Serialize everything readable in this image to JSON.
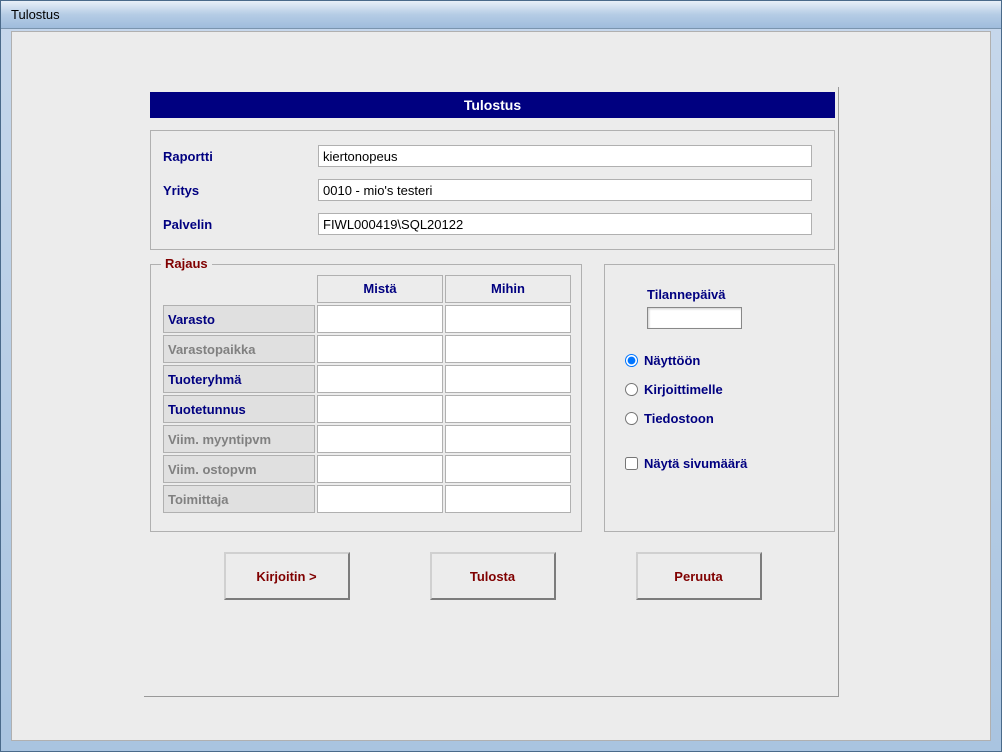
{
  "window": {
    "title": "Tulostus"
  },
  "panel": {
    "header": "Tulostus"
  },
  "info": {
    "report_label": "Raportti",
    "report_value": "kiertonopeus",
    "company_label": "Yritys",
    "company_value": "0010 - mio's testeri",
    "server_label": "Palvelin",
    "server_value": "FIWL000419\\SQL20122"
  },
  "rajaus": {
    "legend": "Rajaus",
    "col_from": "Mistä",
    "col_to": "Mihin",
    "rows": [
      {
        "label": "Varasto",
        "active": true
      },
      {
        "label": "Varastopaikka",
        "active": false
      },
      {
        "label": "Tuoteryhmä",
        "active": true
      },
      {
        "label": "Tuotetunnus",
        "active": true
      },
      {
        "label": "Viim. myyntipvm",
        "active": false
      },
      {
        "label": "Viim. ostopvm",
        "active": false
      },
      {
        "label": "Toimittaja",
        "active": false
      }
    ]
  },
  "right": {
    "tilanne_label": "Tilannepäivä",
    "radio_screen": "Näyttöön",
    "radio_printer": "Kirjoittimelle",
    "radio_file": "Tiedostoon",
    "check_pages": "Näytä sivumäärä"
  },
  "buttons": {
    "printer": "Kirjoitin >",
    "print": "Tulosta",
    "cancel": "Peruuta"
  }
}
